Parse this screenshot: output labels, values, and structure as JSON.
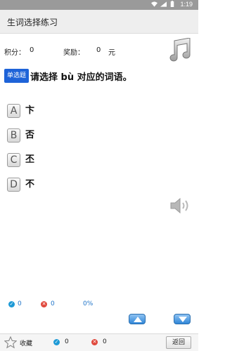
{
  "status_bar": {
    "time": "1:19",
    "icons": [
      "wifi-icon",
      "signal-icon",
      "battery-icon"
    ]
  },
  "header": {
    "title": "生词选择练习"
  },
  "score": {
    "label": "积分：",
    "value": "0",
    "reward_label": "奖励：",
    "reward_value": "0",
    "reward_unit": "元"
  },
  "question": {
    "type_badge": "单选题",
    "text": "请选择 bù 对应的词语。"
  },
  "options": [
    {
      "letter": "A",
      "text": "卞"
    },
    {
      "letter": "B",
      "text": "否"
    },
    {
      "letter": "C",
      "text": "丕"
    },
    {
      "letter": "D",
      "text": "不"
    }
  ],
  "stats": {
    "correct_count": "0",
    "wrong_count": "0",
    "percent": "0%"
  },
  "bottom_bar": {
    "favorite_label": "收藏",
    "correct_count": "0",
    "wrong_count": "0",
    "back_label": "返回"
  },
  "colors": {
    "accent": "#1e63d8",
    "correct": "#1e9ad6",
    "wrong": "#e0483c",
    "stats_text": "#1e73c8"
  }
}
